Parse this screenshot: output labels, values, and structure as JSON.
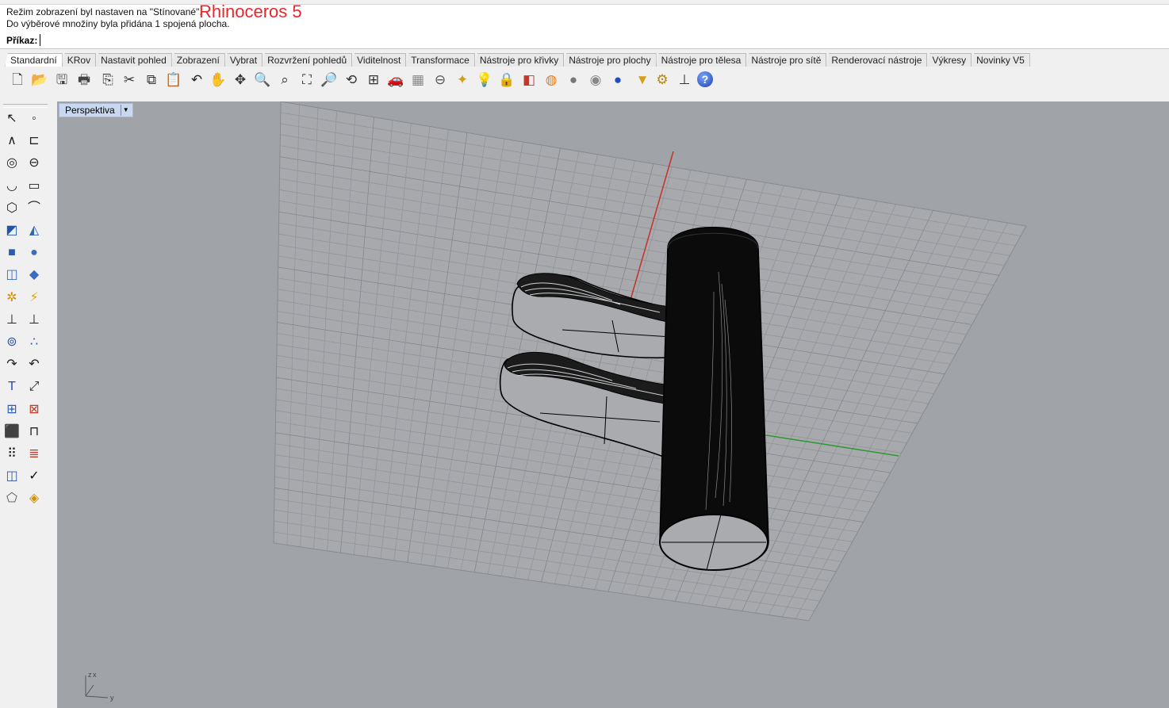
{
  "history": {
    "line1": "Režim zobrazení byl nastaven na \"Stínované\".",
    "line2": "Do výběrové množiny byla přidána 1 spojená plocha.",
    "brand": "Rhinoceros 5"
  },
  "command": {
    "label": "Příkaz:",
    "value": ""
  },
  "tabs": [
    "Standardní",
    "KRov",
    "Nastavit pohled",
    "Zobrazení",
    "Vybrat",
    "Rozvržení pohledů",
    "Viditelnost",
    "Transformace",
    "Nástroje pro křivky",
    "Nástroje pro plochy",
    "Nástroje pro tělesa",
    "Nástroje pro sítě",
    "Renderovací nástroje",
    "Výkresy",
    "Novinky V5"
  ],
  "active_tab": "Standardní",
  "toolbar_icons": [
    "new-file-icon",
    "open-folder-icon",
    "save-icon",
    "print-icon",
    "import-icon",
    "cut-icon",
    "copy-icon",
    "paste-icon",
    "undo-icon",
    "pan-hand-icon",
    "rotate-view-icon",
    "zoom-icon",
    "zoom-window-icon",
    "zoom-extents-icon",
    "zoom-selected-icon",
    "undo-view-icon",
    "four-viewports-icon",
    "car-render-icon",
    "grid-options-icon",
    "layer-icon",
    "snap-icon",
    "light-bulb-icon",
    "lock-icon",
    "layer-colors-icon",
    "color-wheel-icon",
    "shaded-sphere-icon",
    "rendered-sphere-icon",
    "blue-sphere-icon",
    "cone-icon",
    "gear-settings-icon",
    "cplane-icon",
    "help-icon"
  ],
  "left_icons": [
    "select-arrow-icon",
    "point-icon",
    "polyline-icon",
    "curve-points-icon",
    "circle-icon",
    "ellipse-icon",
    "arc-icon",
    "rectangle-icon",
    "polygon-icon",
    "fillet-curve-icon",
    "surface-from-points-icon",
    "loft-surface-icon",
    "box-solid-icon",
    "sphere-boolean-icon",
    "extrude-icon",
    "plane-mesh-icon",
    "explode-gear-icon",
    "trim-icon",
    "split-icon",
    "join-icon",
    "boolean-union-icon",
    "group-points-icon",
    "curve-offset-icon",
    "curve-from-object-icon",
    "text-object-icon",
    "transform-icon",
    "array-icon",
    "mirror-icon",
    "box-edit-icon",
    "dimension-icon",
    "grid-array-icon",
    "align-icon",
    "surface-analysis-icon",
    "check-icon",
    "block-icon",
    "paint-bucket-icon"
  ],
  "viewport": {
    "title": "Perspektiva"
  },
  "axes_icon": {
    "labels": [
      "z",
      "x",
      "y"
    ]
  }
}
